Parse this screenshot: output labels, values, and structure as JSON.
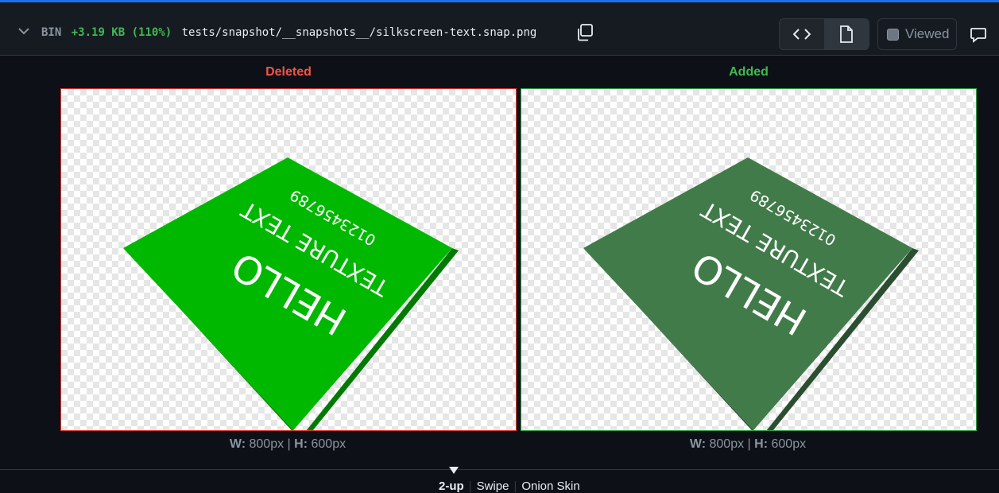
{
  "file_header": {
    "type_label": "BIN",
    "size_change": "+3.19 KB (110%)",
    "file_path": "tests/snapshot/__snapshots__/silkscreen-text.snap.png",
    "viewed_label": "Viewed",
    "viewed_checked": false,
    "icons": [
      "chevron-down-icon",
      "copy-icon",
      "code-icon",
      "file-icon",
      "comment-icon"
    ]
  },
  "comparison": {
    "deleted_label": "Deleted",
    "added_label": "Added",
    "deleted_dims": {
      "w_label": "W:",
      "w_value": "800px",
      "sep": "|",
      "h_label": "H:",
      "h_value": "600px"
    },
    "added_dims": {
      "w_label": "W:",
      "w_value": "800px",
      "sep": "|",
      "h_label": "H:",
      "h_value": "600px"
    },
    "deleted_image": {
      "board_color": "#00b800",
      "board_side_color": "#007a00",
      "text_lines": [
        "HELLO",
        "TEXTURE TEXT",
        "0123456789"
      ]
    },
    "added_image": {
      "board_color": "#427b4a",
      "board_side_color": "#2b4e31",
      "text_lines": [
        "HELLO",
        "TEXTURE TEXT",
        "0123456789"
      ]
    }
  },
  "view_modes": {
    "items": [
      "2-up",
      "Swipe",
      "Onion Skin"
    ],
    "active": "2-up"
  },
  "colors": {
    "accent": "#1f6feb",
    "deleted": "#f85149",
    "added": "#3fb950"
  }
}
